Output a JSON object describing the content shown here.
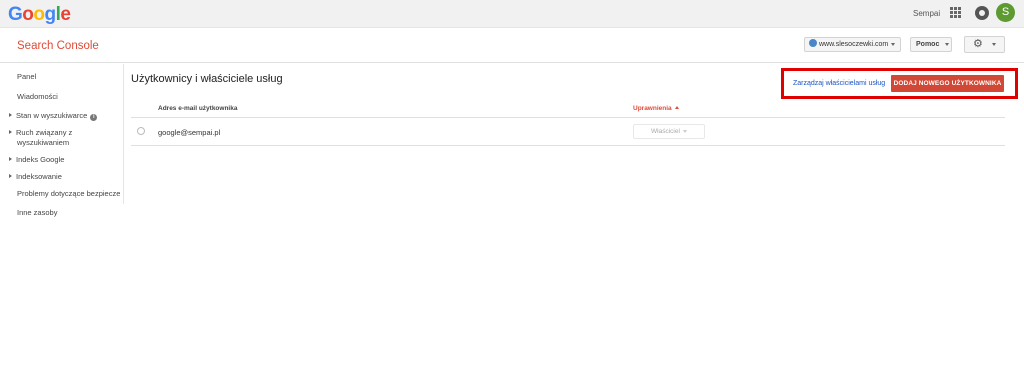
{
  "gbar": {
    "logo_letters": [
      {
        "char": "G",
        "color": "#4285f4"
      },
      {
        "char": "o",
        "color": "#ea4335"
      },
      {
        "char": "o",
        "color": "#fbbc05"
      },
      {
        "char": "g",
        "color": "#4285f4"
      },
      {
        "char": "l",
        "color": "#34a853"
      },
      {
        "char": "e",
        "color": "#ea4335"
      }
    ],
    "username": "Sempai",
    "avatar_letter": "S",
    "icons": [
      "apps-grid-icon",
      "notifications-icon",
      "avatar"
    ]
  },
  "header": {
    "title": "Search Console",
    "site": "www.slesoczewki.com",
    "help_label": "Pomoc",
    "settings_icon": "⚙"
  },
  "sidebar": {
    "items": [
      {
        "label": "Panel",
        "expandable": false
      },
      {
        "label": "Wiadomości",
        "expandable": false
      },
      {
        "label": "Stan w wyszukiwarce",
        "expandable": true,
        "info": true
      },
      {
        "label": "Ruch związany z",
        "label2": "wyszukiwaniem",
        "expandable": true
      },
      {
        "label": "Indeks Google",
        "expandable": true
      },
      {
        "label": "Indeksowanie",
        "expandable": true
      },
      {
        "label": "Problemy dotyczące bezpiecze",
        "expandable": false
      },
      {
        "label": "Inne zasoby",
        "expandable": false
      }
    ]
  },
  "main": {
    "page_title": "Użytkownicy i właściciele usług",
    "manage_link": "Zarządzaj właścicielami usług",
    "add_button": "DODAJ NOWEGO UŻYTKOWNIKA",
    "table": {
      "col_email": "Adres e-mail użytkownika",
      "col_permissions": "Uprawnienia",
      "rows": [
        {
          "email": "google@sempai.pl",
          "role": "Właściciel"
        }
      ]
    }
  },
  "colors": {
    "accent": "#dd4b39",
    "button": "#d14836",
    "link": "#1a55c2",
    "highlight": "#e00000"
  }
}
